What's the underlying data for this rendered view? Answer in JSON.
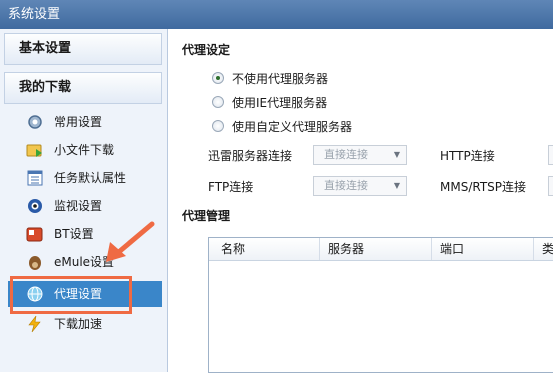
{
  "window": {
    "title": "系统设置"
  },
  "sidebar": {
    "section1": "基本设置",
    "section2": "我的下载",
    "items": [
      {
        "label": "常用设置",
        "icon": "gear-icon"
      },
      {
        "label": "小文件下载",
        "icon": "folder-download-icon"
      },
      {
        "label": "任务默认属性",
        "icon": "list-icon"
      },
      {
        "label": "监视设置",
        "icon": "eye-icon"
      },
      {
        "label": "BT设置",
        "icon": "bt-icon"
      },
      {
        "label": "eMule设置",
        "icon": "mule-icon"
      },
      {
        "label": "代理设置",
        "icon": "proxy-globe-icon",
        "active": true
      },
      {
        "label": "下载加速",
        "icon": "lightning-icon"
      }
    ]
  },
  "proxy": {
    "title": "代理设定",
    "options": [
      {
        "label": "不使用代理服务器",
        "checked": true
      },
      {
        "label": "使用IE代理服务器",
        "checked": false
      },
      {
        "label": "使用自定义代理服务器",
        "checked": false
      }
    ],
    "xunlei_label": "迅雷服务器连接",
    "xunlei_value": "直接连接",
    "http_label": "HTTP连接",
    "ftp_label": "FTP连接",
    "ftp_value": "直接连接",
    "mms_label": "MMS/RTSP连接"
  },
  "manage": {
    "title": "代理管理",
    "columns": [
      "名称",
      "服务器",
      "端口",
      "类"
    ]
  },
  "colors": {
    "titlebar": "#4f78aa",
    "active_item": "#3a86c9",
    "annotation": "#ef6a43"
  }
}
